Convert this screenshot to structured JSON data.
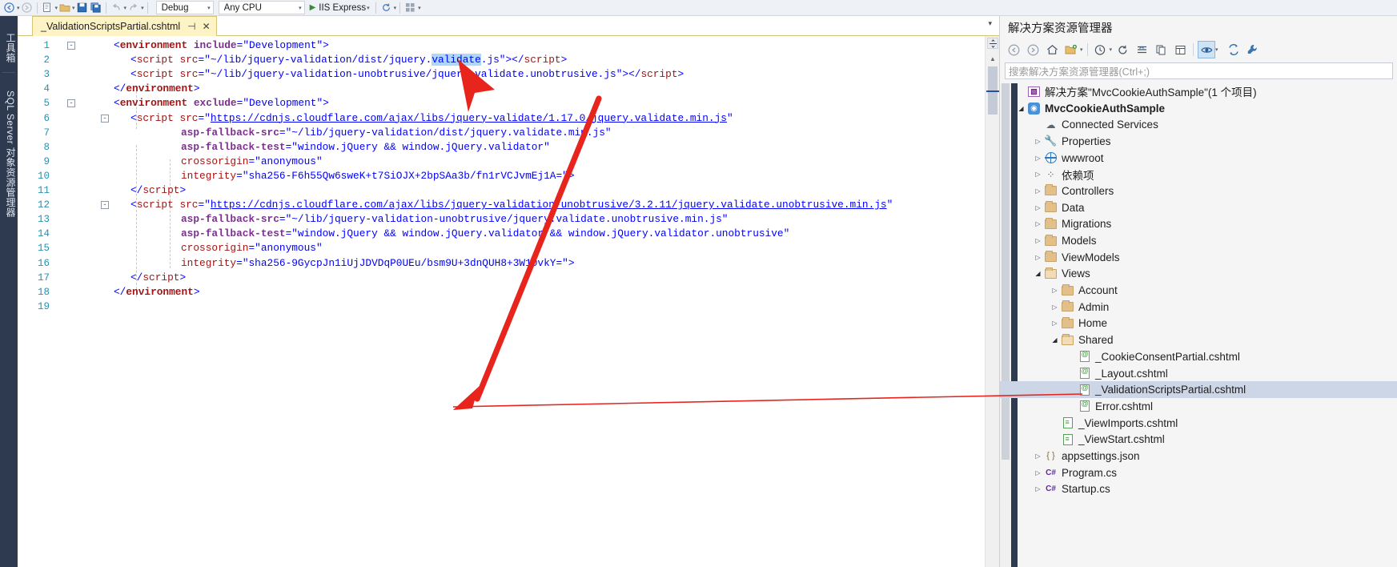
{
  "toolbar": {
    "back_icon": "back-arrow-icon",
    "forward_icon": "forward-arrow-icon",
    "new_item_icon": "new-item-icon",
    "open_icon": "open-file-icon",
    "save_icon": "save-icon",
    "save_all_icon": "save-all-icon",
    "undo_icon": "undo-icon",
    "redo_icon": "redo-icon",
    "config_label": "Debug",
    "platform_label": "Any CPU",
    "run_label": "IIS Express",
    "refresh_icon": "refresh-icon",
    "grid_icon": "grid-icon",
    "caret": "▾"
  },
  "left_dock": {
    "tabs": [
      {
        "label": "工具箱"
      },
      {
        "label": "SQL Server 对象资源管理器"
      }
    ]
  },
  "editor": {
    "tab": {
      "title": "_ValidationScriptsPartial.cshtml",
      "pin": "⊣",
      "close": "✕"
    },
    "tabstrip_overflow": "▾",
    "scrollbar": {
      "split_icon": "split-view-icon",
      "up_arrow": "▲"
    },
    "lines": [
      {
        "no": "1",
        "fold": "-",
        "indent": 0,
        "tokens": [
          {
            "t": "pu",
            "s": "<"
          },
          {
            "t": "envtag",
            "s": "environment"
          },
          {
            "t": "plain",
            "s": " "
          },
          {
            "t": "at",
            "s": "include"
          },
          {
            "t": "pu",
            "s": "="
          },
          {
            "t": "st",
            "s": "\"Development\""
          },
          {
            "t": "pu",
            "s": ">"
          }
        ]
      },
      {
        "no": "2",
        "fold": "",
        "indent": 1,
        "tokens": [
          {
            "t": "pu",
            "s": "<"
          },
          {
            "t": "tg",
            "s": "script"
          },
          {
            "t": "plain",
            "s": " "
          },
          {
            "t": "at2",
            "s": "src"
          },
          {
            "t": "pu",
            "s": "="
          },
          {
            "t": "st",
            "s": "\"~/lib/jquery-validation/dist/jquery."
          },
          {
            "t": "sel",
            "s": "validate"
          },
          {
            "t": "st",
            "s": ".js\""
          },
          {
            "t": "pu",
            "s": ">"
          },
          {
            "t": "pu",
            "s": "</"
          },
          {
            "t": "tg",
            "s": "script"
          },
          {
            "t": "pu",
            "s": ">"
          }
        ]
      },
      {
        "no": "3",
        "fold": "",
        "indent": 1,
        "tokens": [
          {
            "t": "pu",
            "s": "<"
          },
          {
            "t": "tg",
            "s": "script"
          },
          {
            "t": "plain",
            "s": " "
          },
          {
            "t": "at2",
            "s": "src"
          },
          {
            "t": "pu",
            "s": "="
          },
          {
            "t": "st",
            "s": "\"~/lib/jquery-validation-unobtrusive/jquery.validate.unobtrusive.js\""
          },
          {
            "t": "pu",
            "s": ">"
          },
          {
            "t": "pu",
            "s": "</"
          },
          {
            "t": "tg",
            "s": "script"
          },
          {
            "t": "pu",
            "s": ">"
          }
        ]
      },
      {
        "no": "4",
        "fold": "",
        "indent": 0,
        "tokens": [
          {
            "t": "pu",
            "s": "</"
          },
          {
            "t": "envtag",
            "s": "environment"
          },
          {
            "t": "pu",
            "s": ">"
          }
        ]
      },
      {
        "no": "5",
        "fold": "-",
        "indent": 0,
        "tokens": [
          {
            "t": "pu",
            "s": "<"
          },
          {
            "t": "envtag",
            "s": "environment"
          },
          {
            "t": "plain",
            "s": " "
          },
          {
            "t": "at",
            "s": "exclude"
          },
          {
            "t": "pu",
            "s": "="
          },
          {
            "t": "st",
            "s": "\"Development\""
          },
          {
            "t": "pu",
            "s": ">"
          }
        ]
      },
      {
        "no": "6",
        "fold": "-",
        "indent": 1,
        "tokens": [
          {
            "t": "pu",
            "s": "<"
          },
          {
            "t": "tg",
            "s": "script"
          },
          {
            "t": "plain",
            "s": " "
          },
          {
            "t": "at2",
            "s": "src"
          },
          {
            "t": "pu",
            "s": "="
          },
          {
            "t": "st",
            "s": "\""
          },
          {
            "t": "lnk",
            "s": "https://cdnjs.cloudflare.com/ajax/libs/jquery-validate/1.17.0/jquery.validate.min.js"
          },
          {
            "t": "st",
            "s": "\""
          }
        ]
      },
      {
        "no": "7",
        "fold": "",
        "indent": 4,
        "tokens": [
          {
            "t": "at",
            "s": "asp-fallback-src"
          },
          {
            "t": "pu",
            "s": "="
          },
          {
            "t": "st",
            "s": "\"~/lib/jquery-validation/dist/jquery.validate.min.js\""
          }
        ]
      },
      {
        "no": "8",
        "fold": "",
        "indent": 4,
        "tokens": [
          {
            "t": "at",
            "s": "asp-fallback-test"
          },
          {
            "t": "pu",
            "s": "="
          },
          {
            "t": "st",
            "s": "\"window.jQuery && window.jQuery.validator\""
          }
        ]
      },
      {
        "no": "9",
        "fold": "",
        "indent": 4,
        "tokens": [
          {
            "t": "tg",
            "s": "crossorigin"
          },
          {
            "t": "pu",
            "s": "="
          },
          {
            "t": "st",
            "s": "\"anonymous\""
          }
        ]
      },
      {
        "no": "10",
        "fold": "",
        "indent": 4,
        "tokens": [
          {
            "t": "tg",
            "s": "integrity"
          },
          {
            "t": "pu",
            "s": "="
          },
          {
            "t": "st",
            "s": "\"sha256-F6h55Qw6sweK+t7SiOJX+2bpSAa3b/fn1rVCJvmEj1A=\""
          },
          {
            "t": "pu",
            "s": ">"
          }
        ]
      },
      {
        "no": "11",
        "fold": "",
        "indent": 1,
        "tokens": [
          {
            "t": "pu",
            "s": "</"
          },
          {
            "t": "tg",
            "s": "script"
          },
          {
            "t": "pu",
            "s": ">"
          }
        ]
      },
      {
        "no": "12",
        "fold": "-",
        "indent": 1,
        "tokens": [
          {
            "t": "pu",
            "s": "<"
          },
          {
            "t": "tg",
            "s": "script"
          },
          {
            "t": "plain",
            "s": " "
          },
          {
            "t": "at2",
            "s": "src"
          },
          {
            "t": "pu",
            "s": "="
          },
          {
            "t": "st",
            "s": "\""
          },
          {
            "t": "lnk",
            "s": "https://cdnjs.cloudflare.com/ajax/libs/jquery-validation-unobtrusive/3.2.11/jquery.validate.unobtrusive.min.js"
          },
          {
            "t": "st",
            "s": "\""
          }
        ]
      },
      {
        "no": "13",
        "fold": "",
        "indent": 4,
        "tokens": [
          {
            "t": "at",
            "s": "asp-fallback-src"
          },
          {
            "t": "pu",
            "s": "="
          },
          {
            "t": "st",
            "s": "\"~/lib/jquery-validation-unobtrusive/jquery.validate.unobtrusive.min.js\""
          }
        ]
      },
      {
        "no": "14",
        "fold": "",
        "indent": 4,
        "tokens": [
          {
            "t": "at",
            "s": "asp-fallback-test"
          },
          {
            "t": "pu",
            "s": "="
          },
          {
            "t": "st",
            "s": "\"window.jQuery && window.jQuery.validator && window.jQuery.validator.unobtrusive\""
          }
        ]
      },
      {
        "no": "15",
        "fold": "",
        "indent": 4,
        "tokens": [
          {
            "t": "tg",
            "s": "crossorigin"
          },
          {
            "t": "pu",
            "s": "="
          },
          {
            "t": "st",
            "s": "\"anonymous\""
          }
        ]
      },
      {
        "no": "16",
        "fold": "",
        "indent": 4,
        "tokens": [
          {
            "t": "tg",
            "s": "integrity"
          },
          {
            "t": "pu",
            "s": "="
          },
          {
            "t": "st",
            "s": "\"sha256-9GycpJn1iUjJDVDqP0UEu/bsm9U+3dnQUH8+3W10vkY=\""
          },
          {
            "t": "pu",
            "s": ">"
          }
        ]
      },
      {
        "no": "17",
        "fold": "",
        "indent": 1,
        "tokens": [
          {
            "t": "pu",
            "s": "</"
          },
          {
            "t": "tg",
            "s": "script"
          },
          {
            "t": "pu",
            "s": ">"
          }
        ]
      },
      {
        "no": "18",
        "fold": "",
        "indent": 0,
        "tokens": [
          {
            "t": "pu",
            "s": "</"
          },
          {
            "t": "envtag",
            "s": "environment"
          },
          {
            "t": "pu",
            "s": ">"
          }
        ]
      },
      {
        "no": "19",
        "fold": "",
        "indent": 0,
        "tokens": []
      }
    ]
  },
  "solution_explorer": {
    "title": "解决方案资源管理器",
    "search_placeholder": "搜索解决方案资源管理器(Ctrl+;)",
    "toolbar_icons": [
      "back-arrow-icon",
      "forward-arrow-icon",
      "home-icon",
      "new-folder-icon",
      "pending-changes-icon",
      "refresh-icon",
      "collapse-all-icon",
      "show-all-files-icon",
      "properties-icon",
      "preview-selected-items-icon",
      "sync-with-active-document-icon",
      "properties-window-icon"
    ],
    "tree": [
      {
        "depth": 0,
        "twisty": "",
        "icon": "solution-icon",
        "label": "解决方案\"MvcCookieAuthSample\"(1 个项目)",
        "bold": false,
        "selected": false
      },
      {
        "depth": 0,
        "twisty": "▲",
        "icon": "web-project-icon",
        "label": "MvcCookieAuthSample",
        "bold": true,
        "selected": false
      },
      {
        "depth": 1,
        "twisty": "",
        "icon": "connected-services-icon",
        "label": "Connected Services",
        "bold": false,
        "selected": false
      },
      {
        "depth": 1,
        "twisty": "▶",
        "icon": "wrench-icon",
        "label": "Properties",
        "bold": false,
        "selected": false
      },
      {
        "depth": 1,
        "twisty": "▶",
        "icon": "globe-icon",
        "label": "wwwroot",
        "bold": false,
        "selected": false
      },
      {
        "depth": 1,
        "twisty": "▶",
        "icon": "dependencies-icon",
        "label": "依赖项",
        "bold": false,
        "selected": false
      },
      {
        "depth": 1,
        "twisty": "▶",
        "icon": "folder-icon",
        "label": "Controllers",
        "bold": false,
        "selected": false
      },
      {
        "depth": 1,
        "twisty": "▶",
        "icon": "folder-icon",
        "label": "Data",
        "bold": false,
        "selected": false
      },
      {
        "depth": 1,
        "twisty": "▶",
        "icon": "folder-icon",
        "label": "Migrations",
        "bold": false,
        "selected": false
      },
      {
        "depth": 1,
        "twisty": "▶",
        "icon": "folder-icon",
        "label": "Models",
        "bold": false,
        "selected": false
      },
      {
        "depth": 1,
        "twisty": "▶",
        "icon": "folder-icon",
        "label": "ViewModels",
        "bold": false,
        "selected": false
      },
      {
        "depth": 1,
        "twisty": "▲",
        "icon": "folder-open-icon",
        "label": "Views",
        "bold": false,
        "selected": false
      },
      {
        "depth": 2,
        "twisty": "▶",
        "icon": "folder-icon",
        "label": "Account",
        "bold": false,
        "selected": false
      },
      {
        "depth": 2,
        "twisty": "▶",
        "icon": "folder-icon",
        "label": "Admin",
        "bold": false,
        "selected": false
      },
      {
        "depth": 2,
        "twisty": "▶",
        "icon": "folder-icon",
        "label": "Home",
        "bold": false,
        "selected": false
      },
      {
        "depth": 2,
        "twisty": "▲",
        "icon": "folder-open-icon",
        "label": "Shared",
        "bold": false,
        "selected": false
      },
      {
        "depth": 3,
        "twisty": "",
        "icon": "cshtml-file-icon",
        "label": "_CookieConsentPartial.cshtml",
        "bold": false,
        "selected": false
      },
      {
        "depth": 3,
        "twisty": "",
        "icon": "cshtml-file-icon",
        "label": "_Layout.cshtml",
        "bold": false,
        "selected": false
      },
      {
        "depth": 3,
        "twisty": "",
        "icon": "cshtml-file-icon",
        "label": "_ValidationScriptsPartial.cshtml",
        "bold": false,
        "selected": true
      },
      {
        "depth": 3,
        "twisty": "",
        "icon": "cshtml-file-icon",
        "label": "Error.cshtml",
        "bold": false,
        "selected": false
      },
      {
        "depth": 2,
        "twisty": "",
        "icon": "razor-file-icon",
        "label": "_ViewImports.cshtml",
        "bold": false,
        "selected": false
      },
      {
        "depth": 2,
        "twisty": "",
        "icon": "razor-file-icon",
        "label": "_ViewStart.cshtml",
        "bold": false,
        "selected": false
      },
      {
        "depth": 1,
        "twisty": "▶",
        "icon": "json-file-icon",
        "label": "appsettings.json",
        "bold": false,
        "selected": false
      },
      {
        "depth": 1,
        "twisty": "▶",
        "icon": "csharp-file-icon",
        "label": "Program.cs",
        "bold": false,
        "selected": false
      },
      {
        "depth": 1,
        "twisty": "▶",
        "icon": "csharp-file-icon",
        "label": "Startup.cs",
        "bold": false,
        "selected": false
      }
    ]
  },
  "annotation": {
    "color": "#e8251d",
    "description": "red-arrow-annotation"
  }
}
